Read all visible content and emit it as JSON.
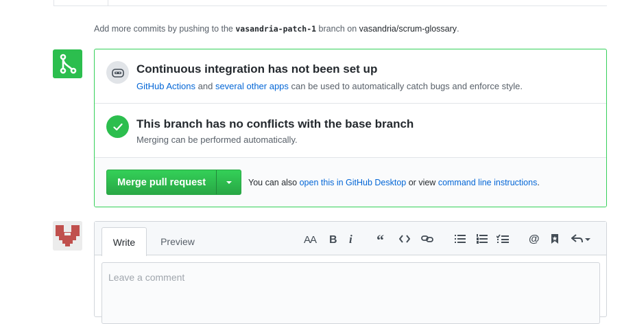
{
  "hint": {
    "prefix": "Add more commits by pushing to the",
    "branch": "vasandria-patch-1",
    "middle": "branch on",
    "repo": "vasandria/scrum-glossary",
    "suffix": "."
  },
  "ci": {
    "title": "Continuous integration has not been set up",
    "link1": "GitHub Actions",
    "and": "and",
    "link2": "several other apps",
    "rest": "can be used to automatically catch bugs and enforce style."
  },
  "conflicts": {
    "title": "This branch has no conflicts with the base branch",
    "subtitle": "Merging can be performed automatically."
  },
  "merge": {
    "button_label": "Merge pull request",
    "alt_prefix": "You can also",
    "alt_link1": "open this in GitHub Desktop",
    "alt_middle": "or view",
    "alt_link2": "command line instructions",
    "alt_suffix": "."
  },
  "comment": {
    "tab_write": "Write",
    "tab_preview": "Preview",
    "placeholder": "Leave a comment"
  },
  "colors": {
    "accent_green": "#2cbe4e",
    "link_blue": "#0366d6",
    "avatar_red": "#c0504d"
  },
  "icons": {
    "merge": "git-merge-icon",
    "ci": "ci-bot-icon",
    "ok": "checkmark-icon",
    "caret": "triangle-down-icon"
  }
}
